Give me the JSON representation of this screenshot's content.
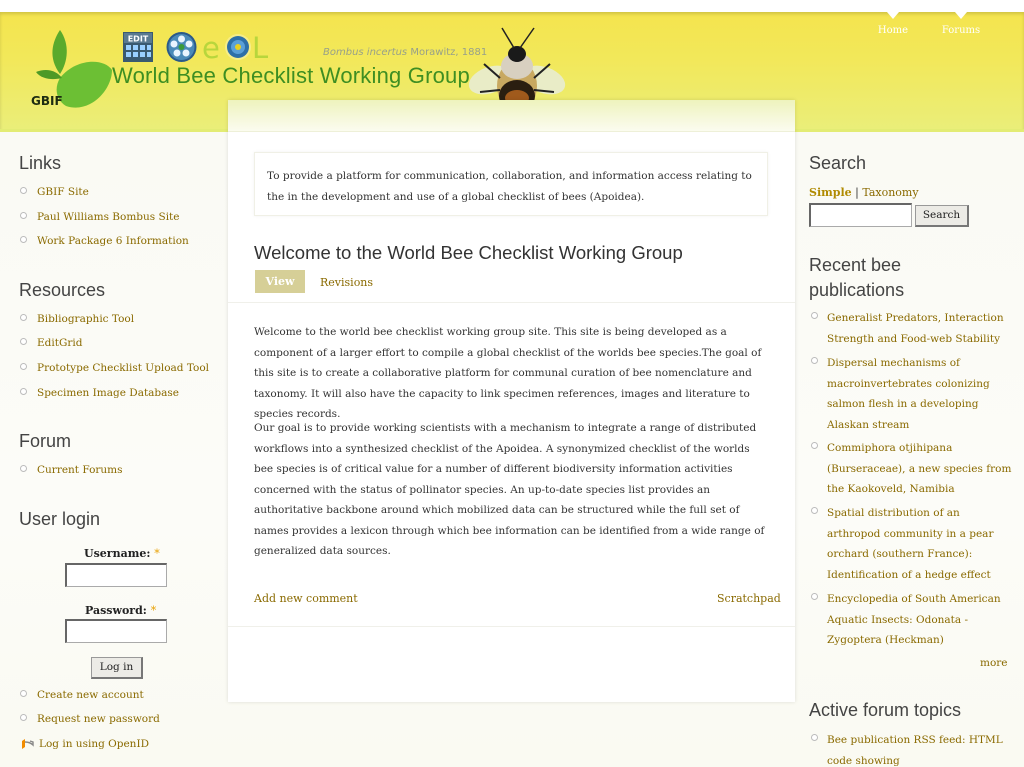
{
  "header": {
    "gbif_text": "GBIF",
    "species_name": "Bombus incertus",
    "species_author": " Morawitz, 1881",
    "site_title": "World Bee Checklist Working Group",
    "nav": [
      {
        "label": "Home"
      },
      {
        "label": "Forums"
      }
    ],
    "colors": {
      "header_yellow": "#f4e44e",
      "title_green": "#3e8e22",
      "link": "#8a6a00"
    }
  },
  "left_sidebar": {
    "links": {
      "title": "Links",
      "items": [
        "GBIF Site",
        "Paul Williams Bombus Site",
        "Work Package 6 Information"
      ]
    },
    "resources": {
      "title": "Resources",
      "items": [
        "Bibliographic Tool",
        "EditGrid",
        "Prototype Checklist Upload Tool",
        "Specimen Image Database"
      ]
    },
    "forum": {
      "title": "Forum",
      "items": [
        "Current Forums"
      ]
    },
    "user_login": {
      "title": "User login",
      "username_label": "Username:",
      "password_label": "Password:",
      "required_mark": "*",
      "login_button": "Log in",
      "links": [
        "Create new account",
        "Request new password",
        "Log in using OpenID"
      ]
    }
  },
  "main": {
    "mission": "To provide a platform for communication, collaboration, and information access relating to the in the development and use of a global checklist of bees (Apoidea).",
    "title": "Welcome to the World Bee Checklist Working Group",
    "tabs": {
      "view": "View",
      "revisions": "Revisions"
    },
    "body": [
      "Welcome to the world bee checklist working group site. This site is being developed as a component of a larger effort to compile a global checklist of the worlds bee species.The goal of this site is to create a collaborative platform for communal curation of bee nomenclature and taxonomy.  It will also have the capacity to link specimen references, images and literature to species records.",
      " Our goal is to provide working scientists with a mechanism to integrate a range of distributed workflows into a synthesized checklist of the Apoidea.  A synonymized checklist of the worlds bee species is of critical value for a number of different biodiversity information activities concerned with the status of pollinator species.  An up-to-date species list provides an authoritative backbone around which mobilized data can be structured while the full set of names provides a lexicon through which bee information can be identified from a wide range of generalized data sources."
    ],
    "links": {
      "add_comment": "Add new comment",
      "scratchpad": "Scratchpad"
    }
  },
  "right_sidebar": {
    "search": {
      "title": "Search",
      "mode_simple": "Simple",
      "mode_separator": " | ",
      "mode_taxonomy": "Taxonomy",
      "button": "Search",
      "value": ""
    },
    "publications": {
      "title_line1": "Recent bee",
      "title_line2": "publications",
      "items": [
        "Generalist Predators, Interaction Strength and Food-web Stability",
        "Dispersal mechanisms of macroinvertebrates colonizing salmon flesh in a developing Alaskan stream",
        "Commiphora otjihipana (Burseraceae), a new species from the Kaokoveld, Namibia",
        "Spatial distribution of an arthropod community in a pear orchard (southern France): Identification of a hedge effect",
        "Encyclopedia of South American Aquatic Insects: Odonata -Zygoptera (Heckman)"
      ],
      "more": "more"
    },
    "forum_topics": {
      "title": "Active forum topics",
      "items": [
        "Bee publication RSS feed: HTML code showing"
      ]
    }
  }
}
